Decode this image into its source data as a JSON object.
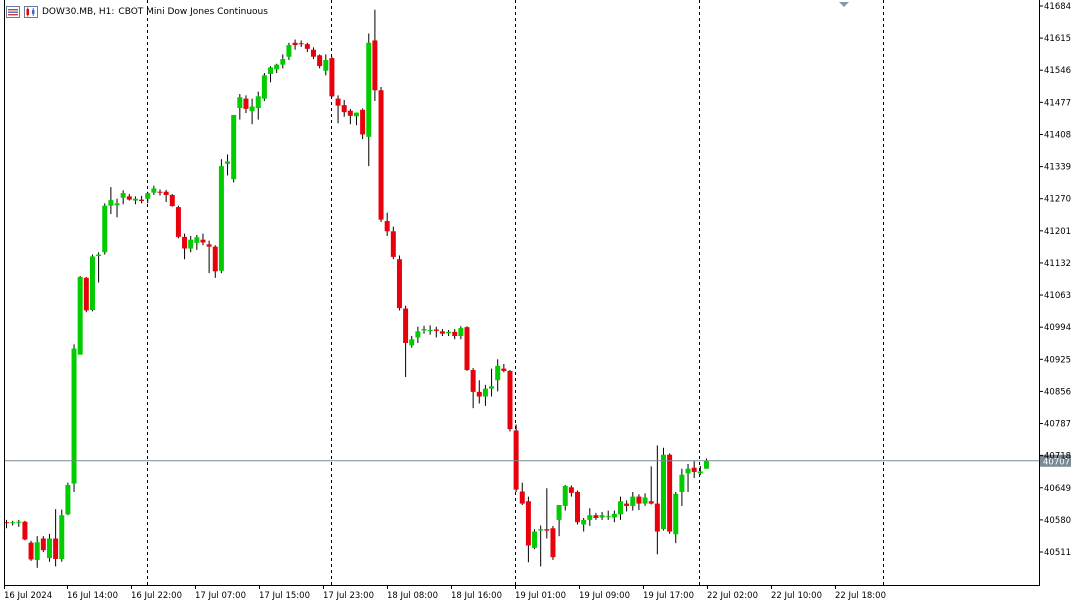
{
  "header": {
    "symbol": "DOW30.MB, H1:",
    "description": "CBOT Mini Dow Jones Continuous",
    "icons": [
      "window-list-icon",
      "chart-type-icon"
    ]
  },
  "colors": {
    "up": "#00cc00",
    "down": "#e8000b",
    "wick": "#000000",
    "grid": "#000000",
    "current_line": "#788a94",
    "price_tag_bg": "#7a8b96",
    "price_tag_text": "#ffffff"
  },
  "current_price_label": "40707",
  "chart_data": {
    "type": "candlestick",
    "title": "",
    "timeframe": "H1",
    "ylim": [
      40456,
      41699
    ],
    "y_ticks": [
      40511,
      40580,
      40649,
      40718,
      40787,
      40856,
      40925,
      40994,
      41063,
      41132,
      41201,
      41270,
      41339,
      41408,
      41477,
      41546,
      41615,
      41684
    ],
    "x_tick_labels": [
      "16 Jul 2024",
      "16 Jul 14:00",
      "16 Jul 22:00",
      "17 Jul 07:00",
      "17 Jul 15:00",
      "17 Jul 23:00",
      "18 Jul 08:00",
      "18 Jul 16:00",
      "19 Jul 01:00",
      "19 Jul 09:00",
      "19 Jul 17:00",
      "22 Jul 02:00",
      "22 Jul 10:00",
      "22 Jul 18:00"
    ],
    "current_price": 40707,
    "grid": "vertical dotted session separators",
    "candles": [
      {
        "o": 40575,
        "h": 40580,
        "l": 40562,
        "c": 40573
      },
      {
        "o": 40575,
        "h": 40578,
        "l": 40568,
        "c": 40575
      },
      {
        "o": 40574,
        "h": 40580,
        "l": 40565,
        "c": 40576
      },
      {
        "o": 40576,
        "h": 40578,
        "l": 40536,
        "c": 40538
      },
      {
        "o": 40531,
        "h": 40535,
        "l": 40492,
        "c": 40495
      },
      {
        "o": 40494,
        "h": 40545,
        "l": 40477,
        "c": 40532
      },
      {
        "o": 40540,
        "h": 40545,
        "l": 40511,
        "c": 40515
      },
      {
        "o": 40498,
        "h": 40550,
        "l": 40490,
        "c": 40540
      },
      {
        "o": 40540,
        "h": 40603,
        "l": 40480,
        "c": 40496
      },
      {
        "o": 40496,
        "h": 40602,
        "l": 40490,
        "c": 40590
      },
      {
        "o": 40592,
        "h": 40660,
        "l": 40590,
        "c": 40655
      },
      {
        "o": 40658,
        "h": 40957,
        "l": 40640,
        "c": 40948
      },
      {
        "o": 40935,
        "h": 41104,
        "l": 40935,
        "c": 41102
      },
      {
        "o": 41100,
        "h": 41102,
        "l": 41026,
        "c": 41030
      },
      {
        "o": 41031,
        "h": 41150,
        "l": 41028,
        "c": 41146
      },
      {
        "o": 41147,
        "h": 41155,
        "l": 41090,
        "c": 41150
      },
      {
        "o": 41155,
        "h": 41260,
        "l": 41150,
        "c": 41255
      },
      {
        "o": 41255,
        "h": 41295,
        "l": 41237,
        "c": 41267
      },
      {
        "o": 41256,
        "h": 41270,
        "l": 41230,
        "c": 41260
      },
      {
        "o": 41272,
        "h": 41288,
        "l": 41258,
        "c": 41282
      },
      {
        "o": 41275,
        "h": 41280,
        "l": 41266,
        "c": 41268
      },
      {
        "o": 41266,
        "h": 41275,
        "l": 41258,
        "c": 41270
      },
      {
        "o": 41268,
        "h": 41276,
        "l": 41260,
        "c": 41265
      },
      {
        "o": 41270,
        "h": 41285,
        "l": 41260,
        "c": 41282
      },
      {
        "o": 41283,
        "h": 41298,
        "l": 41278,
        "c": 41292
      },
      {
        "o": 41285,
        "h": 41290,
        "l": 41277,
        "c": 41284
      },
      {
        "o": 41285,
        "h": 41289,
        "l": 41263,
        "c": 41278
      },
      {
        "o": 41278,
        "h": 41280,
        "l": 41253,
        "c": 41254
      },
      {
        "o": 41252,
        "h": 41255,
        "l": 41185,
        "c": 41188
      },
      {
        "o": 41188,
        "h": 41195,
        "l": 41140,
        "c": 41163
      },
      {
        "o": 41163,
        "h": 41190,
        "l": 41155,
        "c": 41182
      },
      {
        "o": 41175,
        "h": 41192,
        "l": 41160,
        "c": 41187
      },
      {
        "o": 41182,
        "h": 41195,
        "l": 41170,
        "c": 41176
      },
      {
        "o": 41172,
        "h": 41180,
        "l": 41110,
        "c": 41167
      },
      {
        "o": 41167,
        "h": 41170,
        "l": 41100,
        "c": 41114
      },
      {
        "o": 41115,
        "h": 41355,
        "l": 41110,
        "c": 41340
      },
      {
        "o": 41345,
        "h": 41365,
        "l": 41320,
        "c": 41350
      },
      {
        "o": 41312,
        "h": 41448,
        "l": 41305,
        "c": 41450
      },
      {
        "o": 41465,
        "h": 41495,
        "l": 41440,
        "c": 41488
      },
      {
        "o": 41485,
        "h": 41492,
        "l": 41454,
        "c": 41463
      },
      {
        "o": 41458,
        "h": 41485,
        "l": 41430,
        "c": 41468
      },
      {
        "o": 41465,
        "h": 41500,
        "l": 41440,
        "c": 41490
      },
      {
        "o": 41485,
        "h": 41540,
        "l": 41480,
        "c": 41535
      },
      {
        "o": 41538,
        "h": 41555,
        "l": 41520,
        "c": 41552
      },
      {
        "o": 41548,
        "h": 41560,
        "l": 41540,
        "c": 41558
      },
      {
        "o": 41558,
        "h": 41580,
        "l": 41550,
        "c": 41570
      },
      {
        "o": 41575,
        "h": 41605,
        "l": 41568,
        "c": 41600
      },
      {
        "o": 41605,
        "h": 41612,
        "l": 41590,
        "c": 41600
      },
      {
        "o": 41604,
        "h": 41610,
        "l": 41596,
        "c": 41602
      },
      {
        "o": 41602,
        "h": 41605,
        "l": 41585,
        "c": 41592
      },
      {
        "o": 41590,
        "h": 41595,
        "l": 41570,
        "c": 41575
      },
      {
        "o": 41578,
        "h": 41580,
        "l": 41550,
        "c": 41555
      },
      {
        "o": 41545,
        "h": 41580,
        "l": 41535,
        "c": 41568
      },
      {
        "o": 41572,
        "h": 41575,
        "l": 41488,
        "c": 41490
      },
      {
        "o": 41485,
        "h": 41492,
        "l": 41432,
        "c": 41470
      },
      {
        "o": 41471,
        "h": 41482,
        "l": 41446,
        "c": 41456
      },
      {
        "o": 41459,
        "h": 41463,
        "l": 41430,
        "c": 41448
      },
      {
        "o": 41447,
        "h": 41455,
        "l": 41428,
        "c": 41455
      },
      {
        "o": 41461,
        "h": 41464,
        "l": 41398,
        "c": 41408
      },
      {
        "o": 41403,
        "h": 41625,
        "l": 41340,
        "c": 41605
      },
      {
        "o": 41610,
        "h": 41676,
        "l": 41480,
        "c": 41503
      },
      {
        "o": 41503,
        "h": 41510,
        "l": 41220,
        "c": 41225
      },
      {
        "o": 41222,
        "h": 41240,
        "l": 41190,
        "c": 41200
      },
      {
        "o": 41200,
        "h": 41210,
        "l": 41140,
        "c": 41145
      },
      {
        "o": 41140,
        "h": 41148,
        "l": 41030,
        "c": 41035
      },
      {
        "o": 41034,
        "h": 41040,
        "l": 40887,
        "c": 40960
      },
      {
        "o": 40955,
        "h": 40975,
        "l": 40950,
        "c": 40968
      },
      {
        "o": 40972,
        "h": 40995,
        "l": 40960,
        "c": 40985
      },
      {
        "o": 40987,
        "h": 40997,
        "l": 40980,
        "c": 40990
      },
      {
        "o": 40988,
        "h": 40998,
        "l": 40978,
        "c": 40988
      },
      {
        "o": 40989,
        "h": 40995,
        "l": 40972,
        "c": 40986
      },
      {
        "o": 40985,
        "h": 40990,
        "l": 40975,
        "c": 40980
      },
      {
        "o": 40981,
        "h": 40988,
        "l": 40975,
        "c": 40984
      },
      {
        "o": 40984,
        "h": 40990,
        "l": 40968,
        "c": 40975
      },
      {
        "o": 40975,
        "h": 40996,
        "l": 40968,
        "c": 40992
      },
      {
        "o": 40994,
        "h": 40996,
        "l": 40900,
        "c": 40902
      },
      {
        "o": 40902,
        "h": 40906,
        "l": 40820,
        "c": 40855
      },
      {
        "o": 40855,
        "h": 40880,
        "l": 40830,
        "c": 40845
      },
      {
        "o": 40845,
        "h": 40870,
        "l": 40825,
        "c": 40862
      },
      {
        "o": 40862,
        "h": 40905,
        "l": 40845,
        "c": 40867
      },
      {
        "o": 40880,
        "h": 40925,
        "l": 40856,
        "c": 40911
      },
      {
        "o": 40905,
        "h": 40915,
        "l": 40897,
        "c": 40900
      },
      {
        "o": 40900,
        "h": 40902,
        "l": 40770,
        "c": 40775
      },
      {
        "o": 40772,
        "h": 40785,
        "l": 40640,
        "c": 40645
      },
      {
        "o": 40641,
        "h": 40660,
        "l": 40612,
        "c": 40615
      },
      {
        "o": 40620,
        "h": 40630,
        "l": 40489,
        "c": 40525
      },
      {
        "o": 40520,
        "h": 40560,
        "l": 40517,
        "c": 40555
      },
      {
        "o": 40557,
        "h": 40568,
        "l": 40480,
        "c": 40560
      },
      {
        "o": 40560,
        "h": 40648,
        "l": 40540,
        "c": 40557
      },
      {
        "o": 40562,
        "h": 40567,
        "l": 40494,
        "c": 40500
      },
      {
        "o": 40580,
        "h": 40611,
        "l": 40545,
        "c": 40612
      },
      {
        "o": 40610,
        "h": 40655,
        "l": 40600,
        "c": 40653
      },
      {
        "o": 40650,
        "h": 40654,
        "l": 40630,
        "c": 40638
      },
      {
        "o": 40640,
        "h": 40643,
        "l": 40570,
        "c": 40575
      },
      {
        "o": 40570,
        "h": 40584,
        "l": 40555,
        "c": 40580
      },
      {
        "o": 40580,
        "h": 40605,
        "l": 40567,
        "c": 40590
      },
      {
        "o": 40590,
        "h": 40595,
        "l": 40580,
        "c": 40584
      },
      {
        "o": 40585,
        "h": 40597,
        "l": 40580,
        "c": 40590
      },
      {
        "o": 40587,
        "h": 40600,
        "l": 40580,
        "c": 40588
      },
      {
        "o": 40585,
        "h": 40600,
        "l": 40575,
        "c": 40593
      },
      {
        "o": 40592,
        "h": 40630,
        "l": 40580,
        "c": 40620
      },
      {
        "o": 40615,
        "h": 40622,
        "l": 40598,
        "c": 40610
      },
      {
        "o": 40610,
        "h": 40640,
        "l": 40600,
        "c": 40630
      },
      {
        "o": 40630,
        "h": 40635,
        "l": 40601,
        "c": 40615
      },
      {
        "o": 40615,
        "h": 40637,
        "l": 40610,
        "c": 40628
      },
      {
        "o": 40620,
        "h": 40695,
        "l": 40613,
        "c": 40615
      },
      {
        "o": 40615,
        "h": 40740,
        "l": 40506,
        "c": 40555
      },
      {
        "o": 40560,
        "h": 40735,
        "l": 40557,
        "c": 40720
      },
      {
        "o": 40720,
        "h": 40723,
        "l": 40550,
        "c": 40555
      },
      {
        "o": 40549,
        "h": 40640,
        "l": 40530,
        "c": 40636
      },
      {
        "o": 40640,
        "h": 40690,
        "l": 40610,
        "c": 40677
      },
      {
        "o": 40680,
        "h": 40700,
        "l": 40640,
        "c": 40690
      },
      {
        "o": 40692,
        "h": 40706,
        "l": 40670,
        "c": 40683
      },
      {
        "o": 40680,
        "h": 40696,
        "l": 40676,
        "c": 40684
      },
      {
        "o": 40690,
        "h": 40712,
        "l": 40690,
        "c": 40707
      }
    ]
  }
}
